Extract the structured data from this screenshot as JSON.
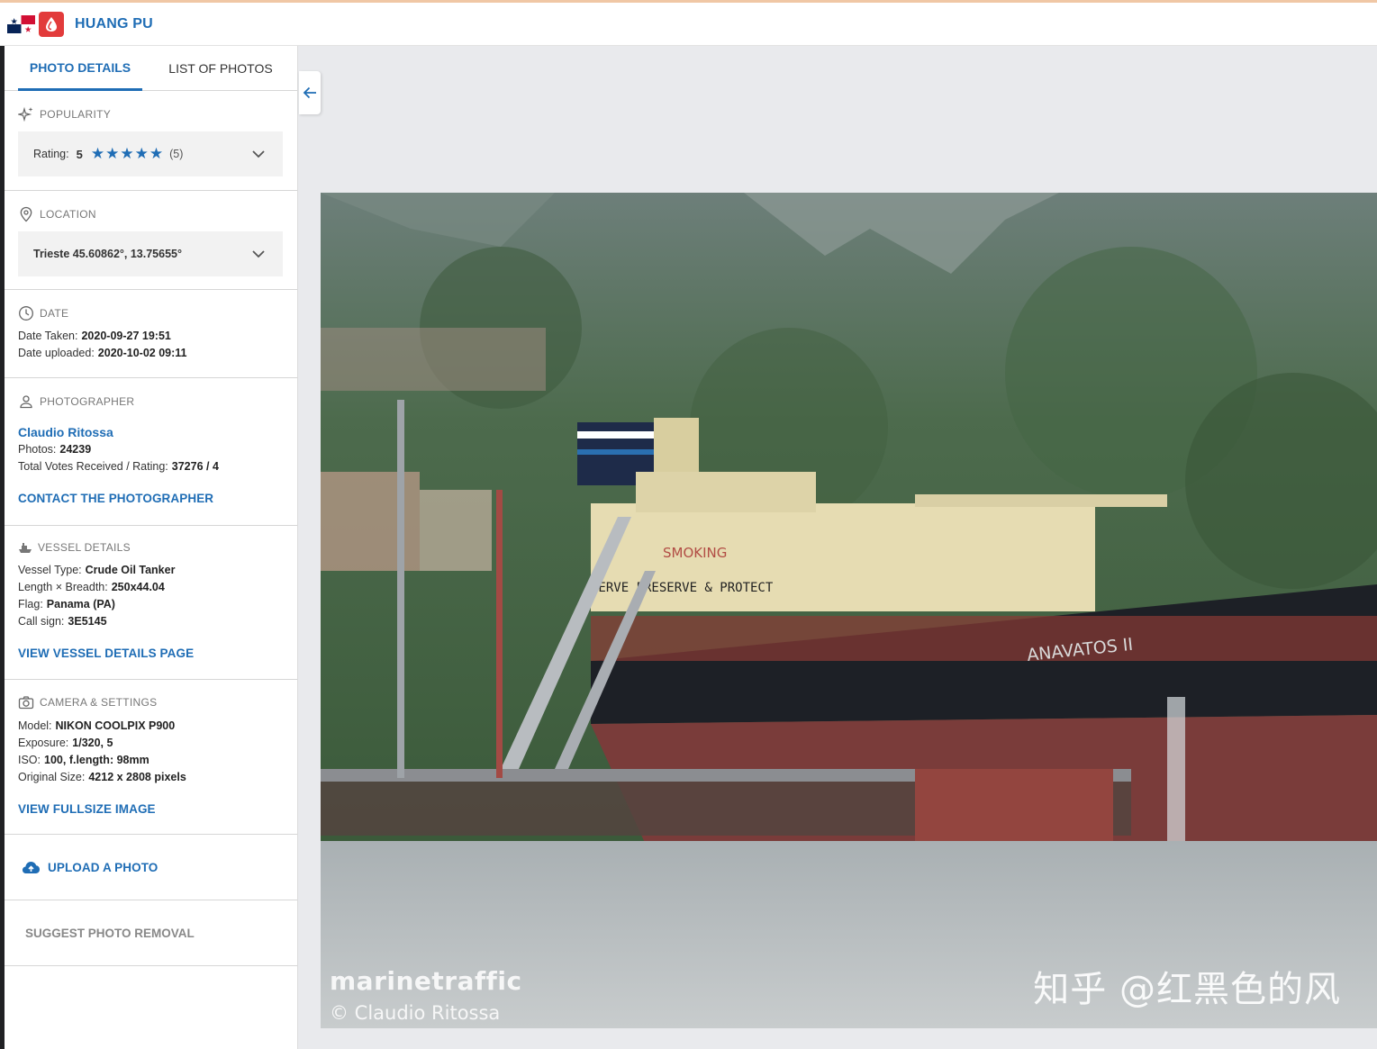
{
  "header": {
    "title": "HUANG PU",
    "flag_icon": "panama-flag-icon",
    "drop_icon": "water-drop-icon",
    "accent": "#1f6db5"
  },
  "tabs": [
    {
      "label": "PHOTO DETAILS",
      "active": true
    },
    {
      "label": "LIST OF PHOTOS",
      "active": false
    }
  ],
  "popularity": {
    "heading": "POPULARITY",
    "rating_label": "Rating:",
    "rating_value": "5",
    "stars": 5,
    "votes": "(5)"
  },
  "location": {
    "heading": "LOCATION",
    "value": "Trieste 45.60862°, 13.75655°"
  },
  "date": {
    "heading": "DATE",
    "taken_label": "Date Taken:",
    "taken_value": "2020-09-27 19:51",
    "uploaded_label": "Date uploaded:",
    "uploaded_value": "2020-10-02 09:11"
  },
  "photographer": {
    "heading": "PHOTOGRAPHER",
    "name": "Claudio Ritossa",
    "photos_label": "Photos:",
    "photos_value": "24239",
    "votes_label": "Total Votes Received / Rating:",
    "votes_value": "37276 / 4",
    "contact": "CONTACT THE PHOTOGRAPHER"
  },
  "vessel": {
    "heading": "VESSEL DETAILS",
    "type_label": "Vessel Type:",
    "type_value": "Crude Oil Tanker",
    "size_label": "Length × Breadth:",
    "size_value": "250x44.04",
    "flag_label": "Flag:",
    "flag_value": "Panama (PA)",
    "call_label": "Call sign:",
    "call_value": "3E5145",
    "link": "VIEW VESSEL DETAILS PAGE"
  },
  "camera": {
    "heading": "CAMERA & SETTINGS",
    "model_label": "Model:",
    "model_value": "NIKON COOLPIX P900",
    "exposure_label": "Exposure:",
    "exposure_value": "1/320, 5",
    "iso_label": "ISO:",
    "iso_value": "100, f.length: 98mm",
    "size_label": "Original Size:",
    "size_value": "4212 x 2808 pixels",
    "link": "VIEW FULLSIZE IMAGE"
  },
  "upload": {
    "label": "UPLOAD A PHOTO"
  },
  "removal": {
    "label": "SUGGEST PHOTO REMOVAL"
  },
  "photo": {
    "watermark_brand": "marinetraffic",
    "watermark_credit": "© Claudio Ritossa",
    "watermark_cn": "知乎 @红黑色的风",
    "hull_name": "ANAVATOS II",
    "superstructure_text_1": "SMOKING",
    "superstructure_text_2": "SERVE PRESERVE & PROTECT"
  }
}
